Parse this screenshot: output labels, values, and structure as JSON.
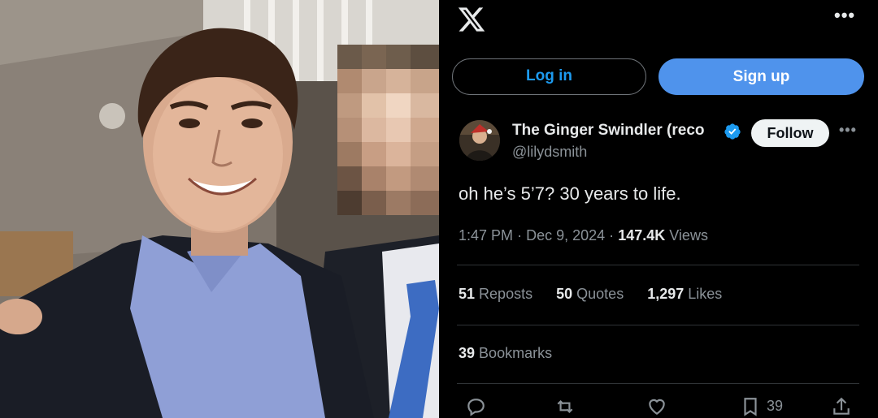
{
  "photo": {
    "description_icon": "photo-image"
  },
  "header": {
    "logo": "x-logo-icon",
    "more": "•••"
  },
  "auth": {
    "login_label": "Log in",
    "signup_label": "Sign up"
  },
  "tweet": {
    "author": {
      "display_name": "The Ginger Swindler (reco",
      "handle": "@lilydsmith",
      "verified_icon": "verified-badge-icon"
    },
    "follow_label": "Follow",
    "more": "•••",
    "text": "oh he’s 5’7? 30 years to life.",
    "time": "1:47 PM",
    "date": "Dec 9, 2024",
    "views_count": "147.4K",
    "views_label": "Views",
    "sep": "·",
    "stats": {
      "reposts_count": "51",
      "reposts_label": "Reposts",
      "quotes_count": "50",
      "quotes_label": "Quotes",
      "likes_count": "1,297",
      "likes_label": "Likes",
      "bookmarks_count": "39",
      "bookmarks_label": "Bookmarks"
    },
    "actions": {
      "bookmark_count": "39"
    }
  },
  "colors": {
    "accent": "#1d9bf0",
    "signup_bg": "#4f93ec",
    "muted": "#8b9298",
    "text": "#e7e9ea",
    "background": "#000000"
  }
}
